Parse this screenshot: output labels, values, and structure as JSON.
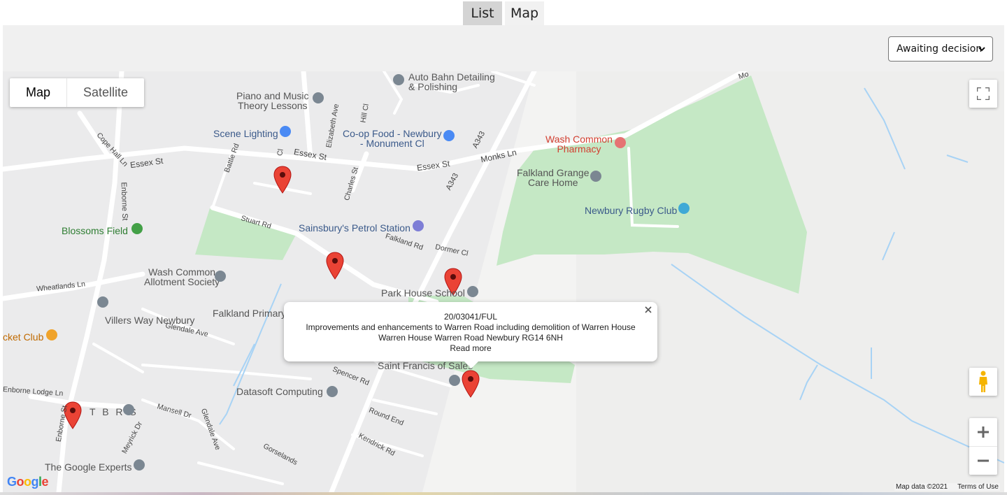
{
  "tabs": [
    {
      "label": "List"
    },
    {
      "label": "Map"
    }
  ],
  "filter": {
    "selected": "Awaiting decision"
  },
  "map": {
    "type_control": {
      "map": "Map",
      "satellite": "Satellite"
    },
    "pois": [
      {
        "name": "Auto Bahn Detailing",
        "line2": "& Polishing"
      },
      {
        "name": "Piano and Music",
        "line2": "Theory Lessons"
      },
      {
        "name": "Scene Lighting"
      },
      {
        "name": "Co-op Food - Newbury",
        "line2": "- Monument Cl"
      },
      {
        "name": "Wash Common",
        "line2": "Pharmacy"
      },
      {
        "name": "Falkland Grange",
        "line2": "Care Home"
      },
      {
        "name": "Newbury Rugby Club"
      },
      {
        "name": "Blossoms Field"
      },
      {
        "name": "Sainsbury's Petrol Station"
      },
      {
        "name": "Wash Common",
        "line2": "Allotment Society"
      },
      {
        "name": "Park House School"
      },
      {
        "name": "Villers Way Newbury"
      },
      {
        "name": "Falkland Primary"
      },
      {
        "name": "cket Club"
      },
      {
        "name": "Saint Francis of Sales"
      },
      {
        "name": "Datasoft Computing"
      },
      {
        "name": "T B R S"
      },
      {
        "name": "The Google Experts"
      }
    ],
    "streets": [
      "Cope Hall Ln",
      "Essex St",
      "Battle Rd",
      "Elizabeth Ave",
      "Hill Cl",
      "Essex St",
      "Essex St",
      "A343",
      "Monks Ln",
      "Enborne St",
      "Stuart Rd",
      "Charles St",
      "Falkland Rd",
      "Dormer Cl",
      "A343",
      "Wheatlands Ln",
      "Glendale Ave",
      "Spencer Rd",
      "Round End",
      "Enborne Lodge Ln",
      "Enborne St",
      "Meyrick Dr",
      "Mansell Dr",
      "Glendale Ave",
      "Gorselands",
      "Kendrick Rd",
      "Mo",
      "Cl"
    ],
    "info_window": {
      "reference": "20/03041/FUL",
      "description": "Improvements and enhancements to Warren Road including demolition of Warren House",
      "address": "Warren House Warren Road Newbury RG14 6NH",
      "link": "Read more"
    },
    "logo": "Google",
    "attribution": {
      "data": "Map data ©2021",
      "terms": "Terms of Use"
    }
  }
}
